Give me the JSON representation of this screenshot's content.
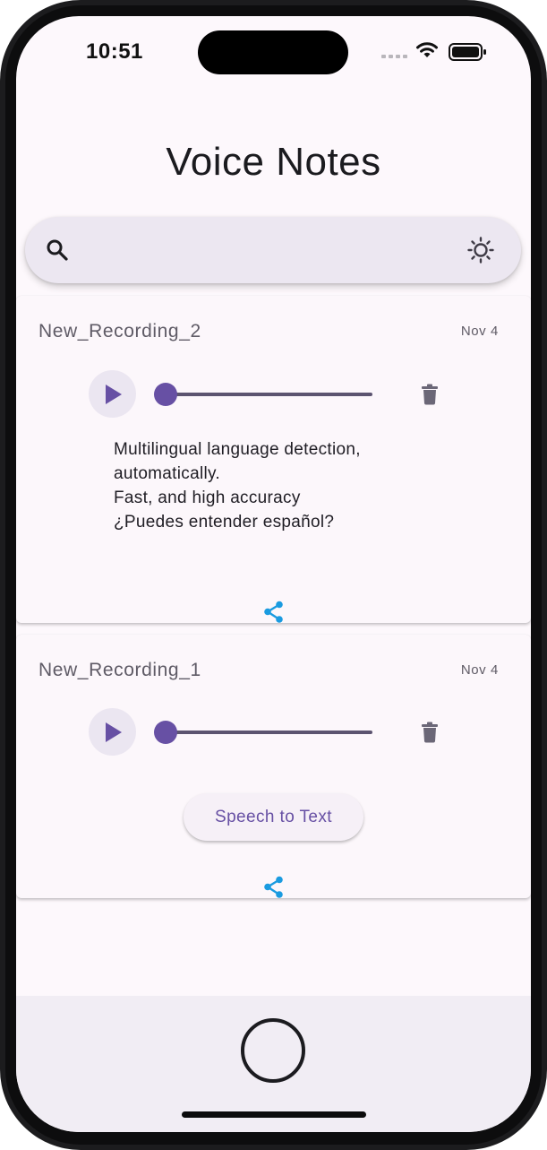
{
  "status_bar": {
    "time": "10:51"
  },
  "header": {
    "title": "Voice Notes"
  },
  "search": {
    "placeholder": ""
  },
  "recordings": [
    {
      "title": "New_Recording_2",
      "date": "Nov 4",
      "progress": 0,
      "transcript": "Multilingual language detection,\nautomatically.\nFast, and high accuracy\n¿Puedes entender español?"
    },
    {
      "title": "New_Recording_1",
      "date": "Nov 4",
      "progress": 0,
      "action_label": "Speech to Text"
    }
  ],
  "icons": {
    "search": "search-icon",
    "theme_toggle": "sun-icon",
    "play": "play-icon",
    "delete": "trash-icon",
    "share": "share-icon",
    "home": "home-button-icon"
  },
  "colors": {
    "accent": "#6750a4",
    "share": "#1a9be0",
    "background": "#fdf8fc"
  }
}
